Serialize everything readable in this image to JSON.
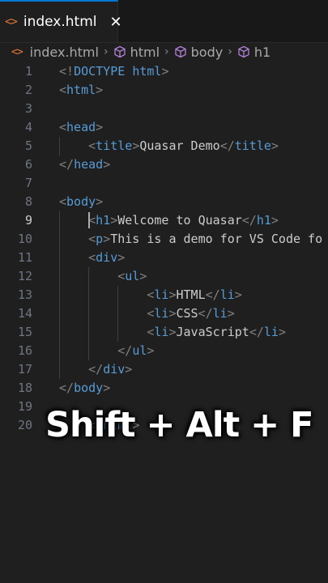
{
  "tab": {
    "icon": "html-file-icon",
    "label": "index.html",
    "close": "✕"
  },
  "breadcrumb": [
    "index.html",
    "html",
    "body",
    "h1"
  ],
  "lines": [
    {
      "n": "1",
      "parts": [
        [
          "br",
          "<!"
        ],
        [
          "tag",
          "DOCTYPE"
        ],
        [
          "txt",
          " "
        ],
        [
          "tag",
          "html"
        ],
        [
          "br",
          ">"
        ]
      ]
    },
    {
      "n": "2",
      "parts": [
        [
          "br",
          "<"
        ],
        [
          "tag",
          "html"
        ],
        [
          "br",
          ">"
        ]
      ]
    },
    {
      "n": "3",
      "parts": []
    },
    {
      "n": "4",
      "parts": [
        [
          "br",
          "<"
        ],
        [
          "tag",
          "head"
        ],
        [
          "br",
          ">"
        ]
      ]
    },
    {
      "n": "5",
      "parts": [
        [
          "txt",
          "    "
        ],
        [
          "br",
          "<"
        ],
        [
          "tag",
          "title"
        ],
        [
          "br",
          ">"
        ],
        [
          "txt",
          "Quasar Demo"
        ],
        [
          "br",
          "</"
        ],
        [
          "tag",
          "title"
        ],
        [
          "br",
          ">"
        ]
      ]
    },
    {
      "n": "6",
      "parts": [
        [
          "br",
          "</"
        ],
        [
          "tag",
          "head"
        ],
        [
          "br",
          ">"
        ]
      ]
    },
    {
      "n": "7",
      "parts": []
    },
    {
      "n": "8",
      "parts": [
        [
          "br",
          "<"
        ],
        [
          "tag",
          "body"
        ],
        [
          "br",
          ">"
        ]
      ]
    },
    {
      "n": "9",
      "parts": [
        [
          "txt",
          "    "
        ],
        [
          "br",
          "<"
        ],
        [
          "tag",
          "h1"
        ],
        [
          "br",
          ">"
        ],
        [
          "txt",
          "Welcome to Quasar"
        ],
        [
          "br",
          "</"
        ],
        [
          "tag",
          "h1"
        ],
        [
          "br",
          ">"
        ]
      ]
    },
    {
      "n": "10",
      "parts": [
        [
          "txt",
          "    "
        ],
        [
          "br",
          "<"
        ],
        [
          "tag",
          "p"
        ],
        [
          "br",
          ">"
        ],
        [
          "txt",
          "This is a demo for VS Code fo"
        ]
      ]
    },
    {
      "n": "11",
      "parts": [
        [
          "txt",
          "    "
        ],
        [
          "br",
          "<"
        ],
        [
          "tag",
          "div"
        ],
        [
          "br",
          ">"
        ]
      ]
    },
    {
      "n": "12",
      "parts": [
        [
          "txt",
          "        "
        ],
        [
          "br",
          "<"
        ],
        [
          "tag",
          "ul"
        ],
        [
          "br",
          ">"
        ]
      ]
    },
    {
      "n": "13",
      "parts": [
        [
          "txt",
          "            "
        ],
        [
          "br",
          "<"
        ],
        [
          "tag",
          "li"
        ],
        [
          "br",
          ">"
        ],
        [
          "txt",
          "HTML"
        ],
        [
          "br",
          "</"
        ],
        [
          "tag",
          "li"
        ],
        [
          "br",
          ">"
        ]
      ]
    },
    {
      "n": "14",
      "parts": [
        [
          "txt",
          "            "
        ],
        [
          "br",
          "<"
        ],
        [
          "tag",
          "li"
        ],
        [
          "br",
          ">"
        ],
        [
          "txt",
          "CSS"
        ],
        [
          "br",
          "</"
        ],
        [
          "tag",
          "li"
        ],
        [
          "br",
          ">"
        ]
      ]
    },
    {
      "n": "15",
      "parts": [
        [
          "txt",
          "            "
        ],
        [
          "br",
          "<"
        ],
        [
          "tag",
          "li"
        ],
        [
          "br",
          ">"
        ],
        [
          "txt",
          "JavaScript"
        ],
        [
          "br",
          "</"
        ],
        [
          "tag",
          "li"
        ],
        [
          "br",
          ">"
        ]
      ]
    },
    {
      "n": "16",
      "parts": [
        [
          "txt",
          "        "
        ],
        [
          "br",
          "</"
        ],
        [
          "tag",
          "ul"
        ],
        [
          "br",
          ">"
        ]
      ]
    },
    {
      "n": "17",
      "parts": [
        [
          "txt",
          "    "
        ],
        [
          "br",
          "</"
        ],
        [
          "tag",
          "div"
        ],
        [
          "br",
          ">"
        ]
      ]
    },
    {
      "n": "18",
      "parts": [
        [
          "br",
          "</"
        ],
        [
          "tag",
          "body"
        ],
        [
          "br",
          ">"
        ]
      ]
    },
    {
      "n": "19",
      "parts": []
    },
    {
      "n": "20",
      "parts": [
        [
          "txt",
          "    "
        ],
        [
          "br",
          "</"
        ],
        [
          "tag",
          "html"
        ],
        [
          "br",
          ">"
        ]
      ]
    }
  ],
  "active_line": "9",
  "caption": "Shift + Alt + F"
}
